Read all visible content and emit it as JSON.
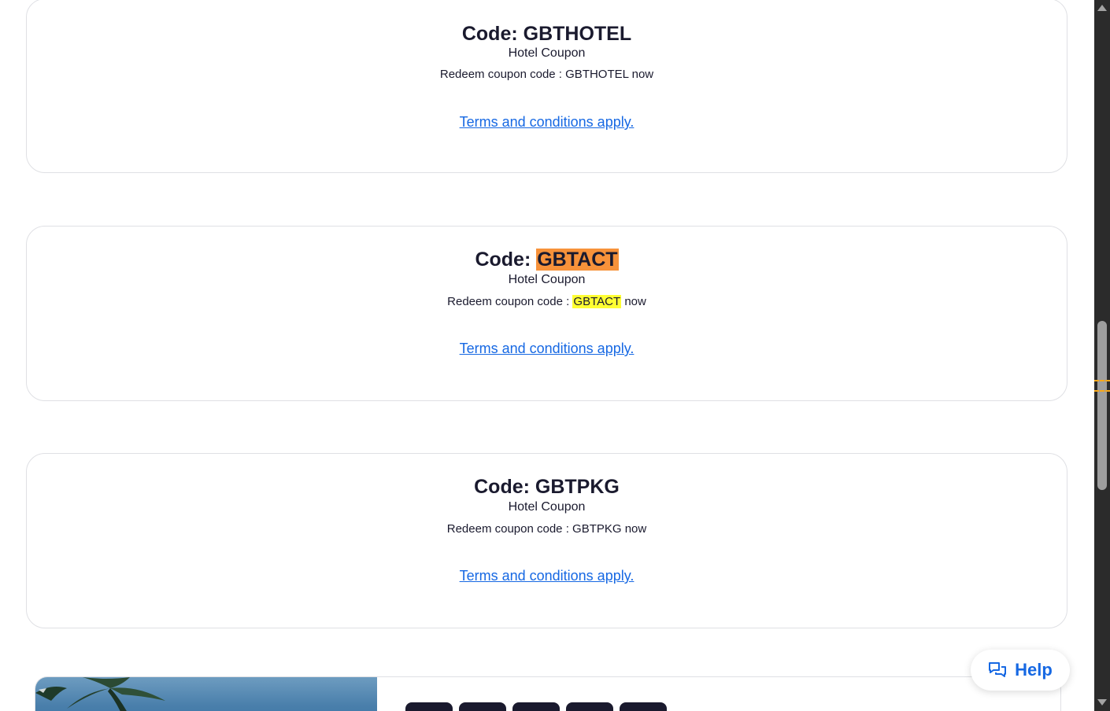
{
  "coupons": [
    {
      "code_label": "Code:",
      "code": "GBTHOTEL",
      "type": "Hotel Coupon",
      "redeem_prefix": "Redeem coupon code :",
      "redeem_code": "GBTHOTEL",
      "redeem_suffix": "now",
      "terms": "Terms and conditions apply."
    },
    {
      "code_label": "Code:",
      "code": "GBTACT",
      "type": "Hotel Coupon",
      "redeem_prefix": "Redeem coupon code :",
      "redeem_code": "GBTACT",
      "redeem_suffix": "now",
      "terms": "Terms and conditions apply."
    },
    {
      "code_label": "Code:",
      "code": "GBTPKG",
      "type": "Hotel Coupon",
      "redeem_prefix": "Redeem coupon code :",
      "redeem_code": "GBTPKG",
      "redeem_suffix": "now",
      "terms": "Terms and conditions apply."
    }
  ],
  "help": {
    "label": "Help",
    "icon": "chat-bubbles-icon"
  },
  "colors": {
    "link": "#1668e3",
    "highlight_current": "#f7923a",
    "highlight_match": "#ffff33",
    "text": "#1a1a2e",
    "card_border": "#dfe0e4"
  },
  "scrollbar": {
    "thumb_fraction": 0.28
  }
}
